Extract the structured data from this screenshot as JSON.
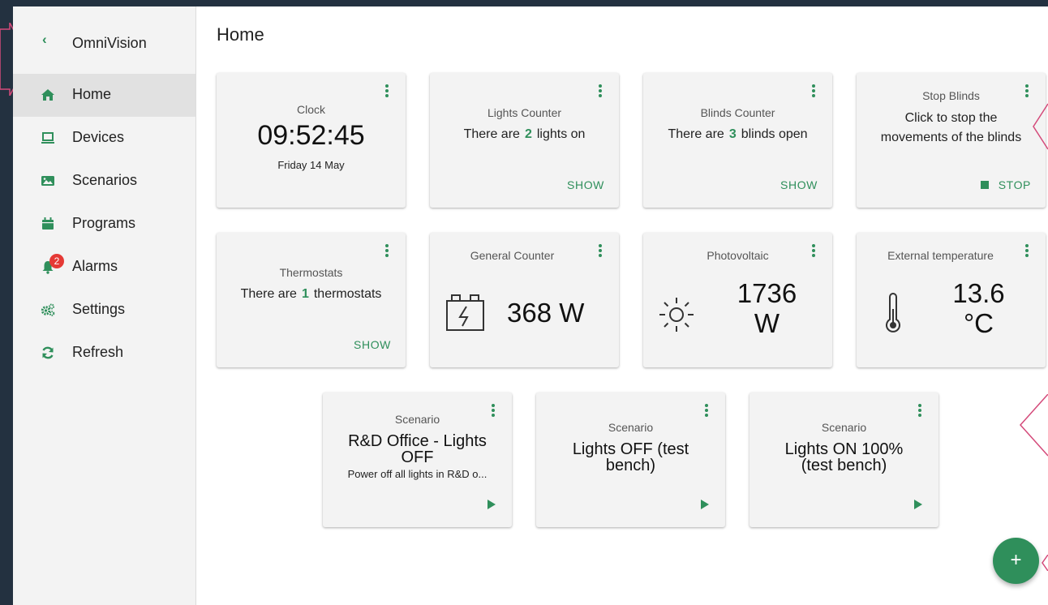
{
  "app": {
    "name": "OmniVision"
  },
  "page": {
    "title": "Home"
  },
  "sidebar": {
    "items": [
      {
        "label": "Home",
        "icon": "home-icon",
        "active": true
      },
      {
        "label": "Devices",
        "icon": "laptop-icon"
      },
      {
        "label": "Scenarios",
        "icon": "image-icon"
      },
      {
        "label": "Programs",
        "icon": "calendar-icon"
      },
      {
        "label": "Alarms",
        "icon": "bell-icon",
        "badge": "2"
      },
      {
        "label": "Settings",
        "icon": "gears-icon"
      },
      {
        "label": "Refresh",
        "icon": "refresh-icon"
      }
    ]
  },
  "cards": {
    "clock": {
      "title": "Clock",
      "time": "09:52:45",
      "date": "Friday 14 May"
    },
    "lights": {
      "title": "Lights Counter",
      "prefix": "There are",
      "count": "2",
      "suffix": "lights on",
      "action": "SHOW"
    },
    "blinds": {
      "title": "Blinds Counter",
      "prefix": "There are",
      "count": "3",
      "suffix": "blinds open",
      "action": "SHOW"
    },
    "stop_blinds": {
      "title": "Stop Blinds",
      "text": "Click to stop the movements of the blinds",
      "action": "STOP"
    },
    "thermostats": {
      "title": "Thermostats",
      "prefix": "There are",
      "count": "1",
      "suffix": "thermostats",
      "action": "SHOW"
    },
    "general_counter": {
      "title": "General Counter",
      "value": "368 W",
      "icon": "battery-charging-icon"
    },
    "photovoltaic": {
      "title": "Photovoltaic",
      "value": "1736",
      "unit": "W",
      "icon": "sun-icon"
    },
    "external_temp": {
      "title": "External temperature",
      "value": "13.6",
      "unit": "°C",
      "icon": "thermometer-icon"
    },
    "scenario1": {
      "title": "Scenario",
      "name": "R&D Office - Lights OFF",
      "description": "Power off all lights in R&D o..."
    },
    "scenario2": {
      "title": "Scenario",
      "name": "Lights OFF (test bench)"
    },
    "scenario3": {
      "title": "Scenario",
      "name": "Lights ON 100% (test bench)"
    }
  },
  "fab": {
    "label": "+"
  },
  "colors": {
    "accent": "#2f8f5b",
    "badge": "#e53935",
    "sidebar": "#f3f3f3",
    "card": "#f3f3f3",
    "annotation": "#d44a7a",
    "background": "#233140"
  }
}
